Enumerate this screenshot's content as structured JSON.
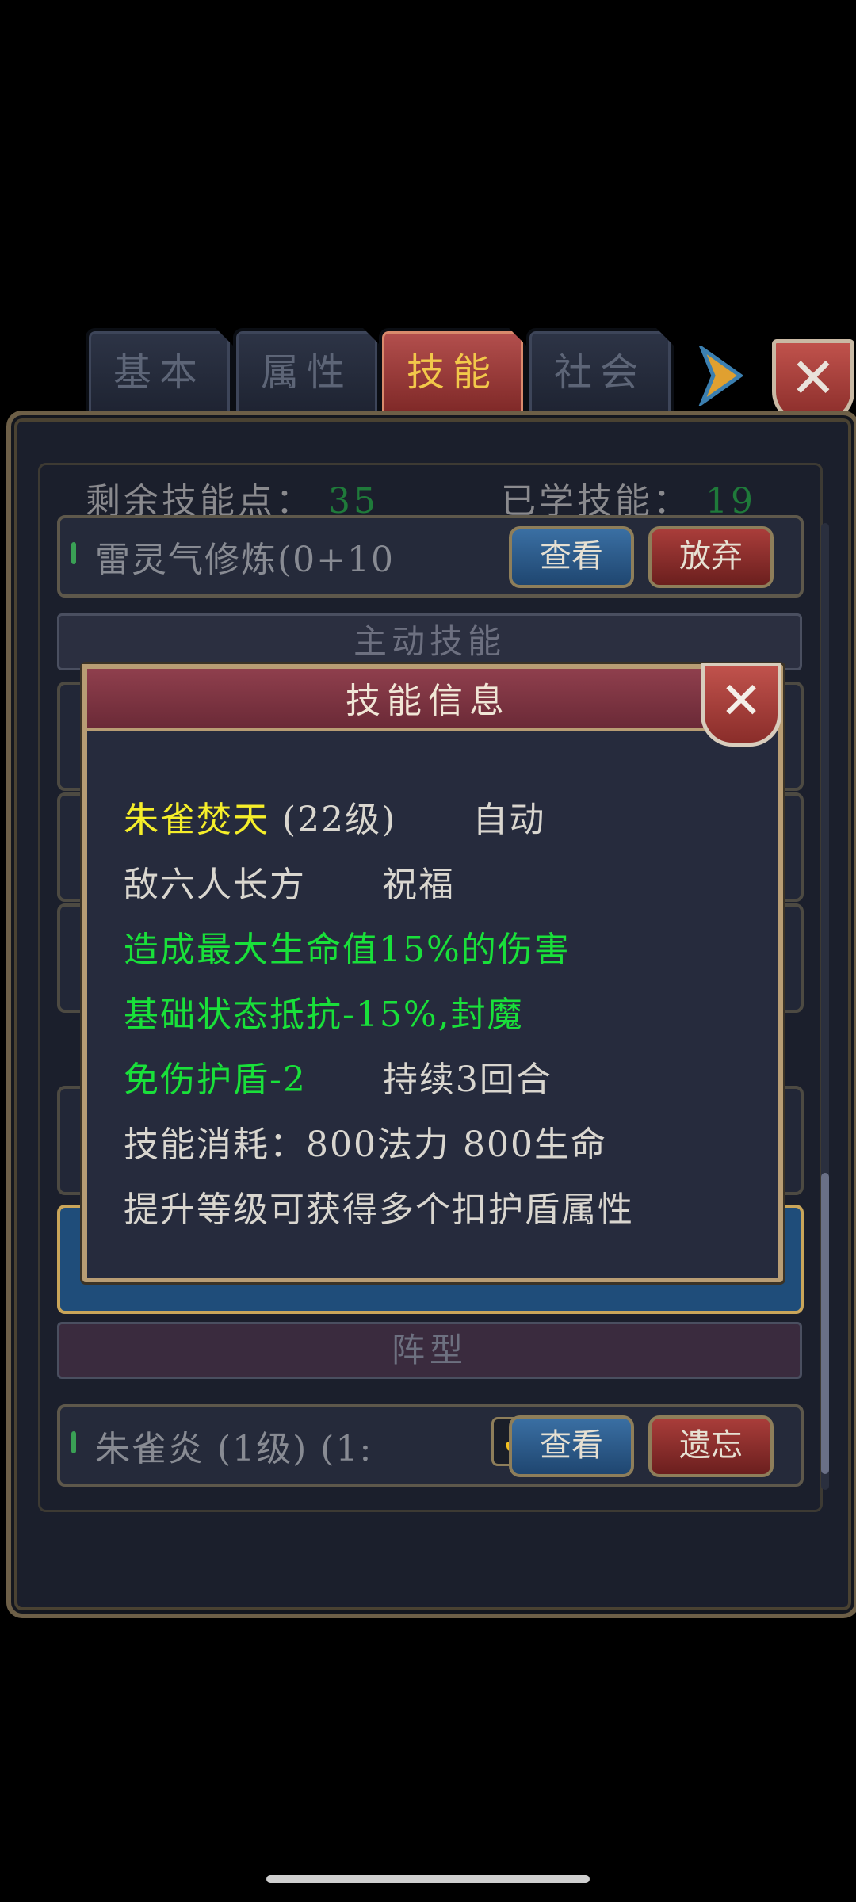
{
  "tabs": [
    "基本",
    "属性",
    "技能",
    "社会"
  ],
  "active_tab": "技能",
  "stats": {
    "remaining_label": "剩余技能点：",
    "remaining_value": "35",
    "learned_label": "已学技能：",
    "learned_value": "19"
  },
  "skill_rows": [
    {
      "name": "雷灵气修炼(0+10",
      "view": "查看",
      "action": "放弃"
    }
  ],
  "section_active": "主动技能",
  "section_formation": "阵型",
  "formation_row": {
    "name": "朱雀炎 (1级) (1:",
    "view": "查看",
    "action": "遗忘"
  },
  "dialog": {
    "title": "技能信息",
    "lines": {
      "l1a": "朱雀焚天",
      "l1b": "(22级)",
      "l1c": "自动",
      "l2a": "敌六人长方",
      "l2b": "祝福",
      "l3": "造成最大生命值15%的伤害",
      "l4": "基础状态抵抗-15%,封魔",
      "l5a": "免伤护盾-2",
      "l5b": "持续3回合",
      "l6": "技能消耗：800法力 800生命",
      "l7": "提升等级可获得多个扣护盾属性"
    }
  },
  "colors": {
    "yellow": "#f5ee2a",
    "green": "#19e03a",
    "text": "#d9d6cf"
  }
}
